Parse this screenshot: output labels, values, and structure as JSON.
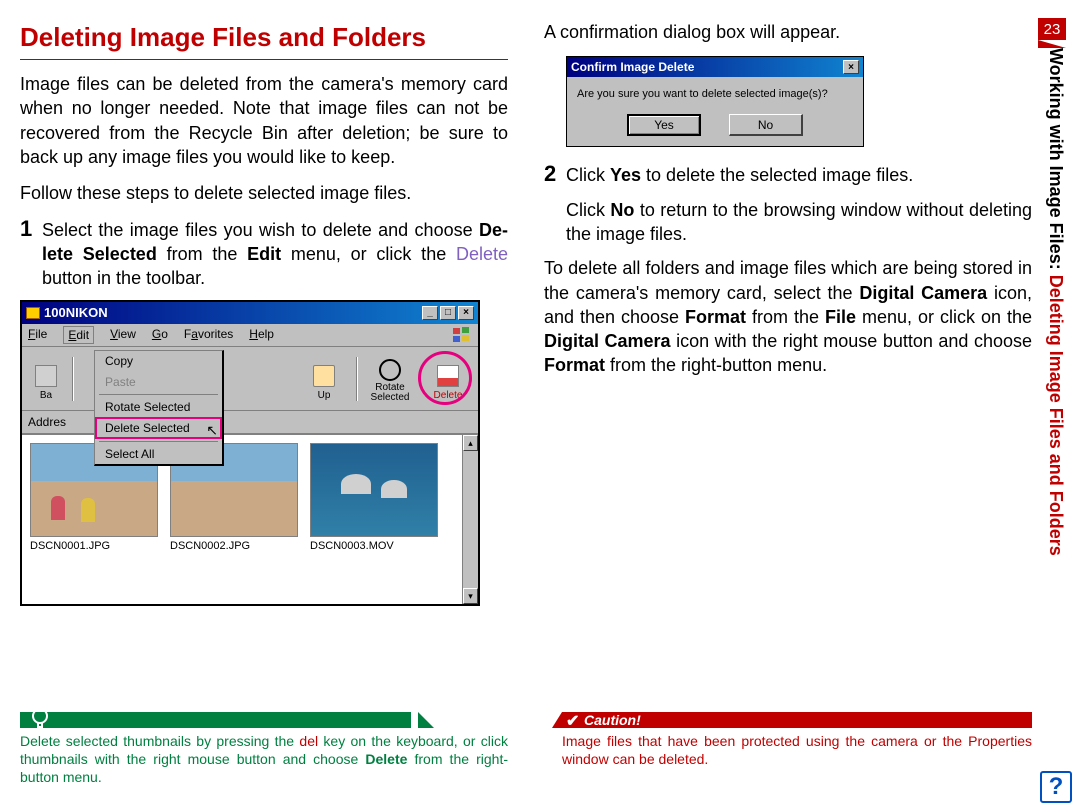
{
  "page_number": "23",
  "sidebar": {
    "blk": "Working with Image Files: ",
    "red": "Deleting Image Files and Folders"
  },
  "left": {
    "heading": "Deleting Image Files and Folders",
    "intro": "Image files can be deleted from the camera's memory card when no longer needed.  Note that image files can not be recovered from the Recycle Bin after deletion; be sure to back up any image files you would like to keep.",
    "follow": "Follow these steps to delete selected image files.",
    "step1_a": "Select the image files you wish to delete and choose ",
    "step1_b": "De­lete Selected",
    "step1_c": " from the ",
    "step1_d": "Edit",
    "step1_e": " menu, or click the ",
    "step1_f": "Delete",
    "step1_g": " button in the toolbar."
  },
  "right": {
    "confirm_lead": "A confirmation dialog box will appear.",
    "step2_a": "Click ",
    "step2_b": "Yes",
    "step2_c": " to delete the selected image files.",
    "step2_no_a": "Click ",
    "step2_no_b": "No",
    "step2_no_c": " to return to the browsing window without delet­ing the image files.",
    "para_a": "To delete all folders and image files which are being stored in the camera's memory card, select the ",
    "para_b": "Digital Camera",
    "para_c": " icon, and then choose ",
    "para_d": "Format",
    "para_e": " from the ",
    "para_f": "File",
    "para_g": " menu, or click on the ",
    "para_h": "Digital Camera",
    "para_i": " icon with the right mouse button and choose ",
    "para_j": "Format",
    "para_k": " from the right-button menu."
  },
  "green_note": {
    "a": "Delete selected thumbnails by pressing the ",
    "b": "del",
    "c": " key on the keyboard, or click thumbnails with the right mouse button and choose ",
    "d": "Delete",
    "e": " from the right-button menu."
  },
  "red_note": {
    "label": "Caution!",
    "text": "Image files that have been protected using the camera or the Properties window can be deleted."
  },
  "browser": {
    "title": "100NIKON",
    "menu": {
      "file": "File",
      "edit": "Edit",
      "view": "View",
      "go": "Go",
      "fav": "Favorites",
      "help": "Help"
    },
    "tool": {
      "back": "Ba",
      "up": "Up",
      "rotate": "Rotate Selected",
      "delete": "Delete"
    },
    "address_label": "Addres",
    "dropdown": {
      "copy": "Copy",
      "paste": "Paste",
      "rotate": "Rotate Selected",
      "delete_sel": "Delete Selected",
      "select_all": "Select All"
    },
    "thumbs": [
      "DSCN0001.JPG",
      "DSCN0002.JPG",
      "DSCN0003.MOV"
    ]
  },
  "dialog": {
    "title": "Confirm Image Delete",
    "msg": "Are you sure you want to delete selected image(s)?",
    "yes": "Yes",
    "no": "No"
  }
}
